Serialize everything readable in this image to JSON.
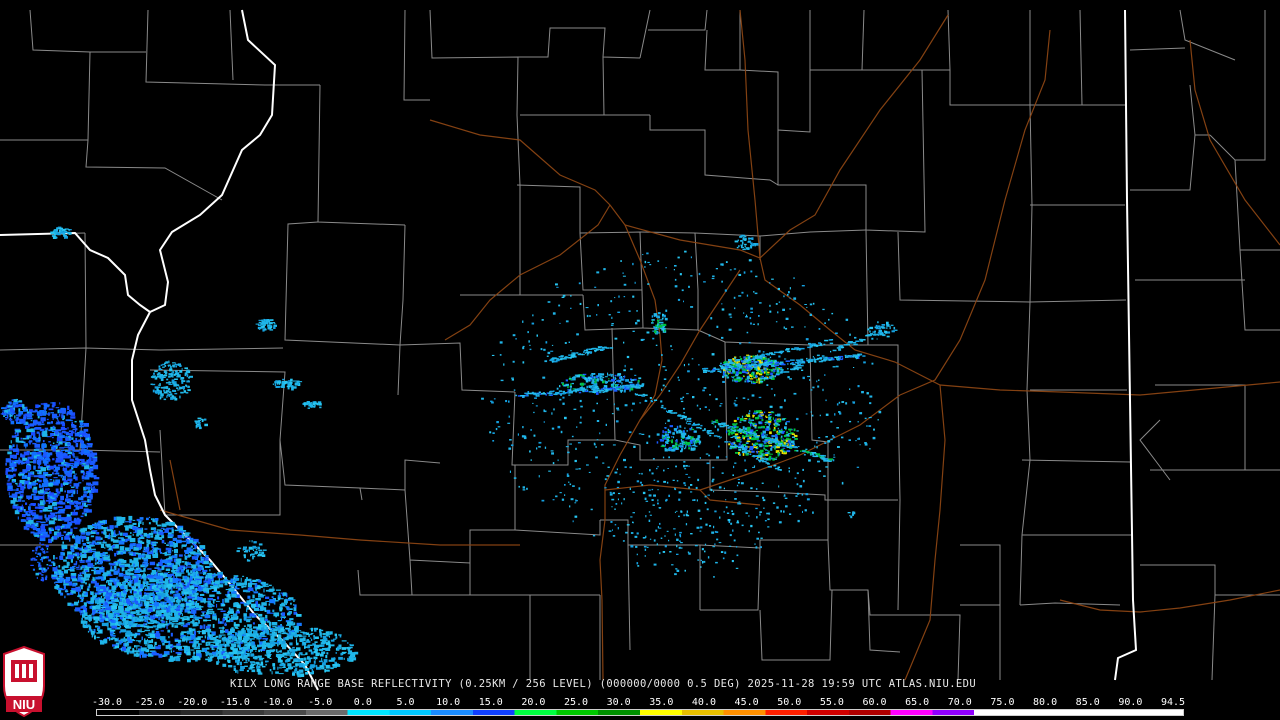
{
  "product": {
    "caption": "KILX LONG RANGE BASE REFLECTIVITY (0.25KM / 256 LEVEL) (000000/0000 0.5 DEG) 2025-11-28 19:59 UTC  ATLAS.NIU.EDU"
  },
  "logo": {
    "text": "NIU",
    "color": "#c8102e"
  },
  "scale": {
    "labels": [
      "-30.0",
      "-25.0",
      "-20.0",
      "-15.0",
      "-10.0",
      "-5.0",
      "0.0",
      "5.0",
      "10.0",
      "15.0",
      "20.0",
      "25.0",
      "30.0",
      "35.0",
      "40.0",
      "45.0",
      "50.0",
      "55.0",
      "60.0",
      "65.0",
      "70.0",
      "75.0",
      "80.0",
      "85.0",
      "90.0",
      "94.5"
    ],
    "colors": [
      "#000000",
      "#1a1a1a",
      "#2a2a2a",
      "#3a3a3a",
      "#4a4a4a",
      "#6a6a6a",
      "#00e5ff",
      "#00c8ff",
      "#1a8cff",
      "#1040ff",
      "#00ff40",
      "#00c800",
      "#009000",
      "#ffff00",
      "#e8c000",
      "#ff9000",
      "#ff2000",
      "#d00000",
      "#b00000",
      "#ff00ff",
      "#9000ff",
      "#ffffff",
      "#ffffff",
      "#ffffff",
      "#ffffff",
      "#ffffff"
    ]
  },
  "map": {
    "colors": {
      "county_border": "#8c8c8c",
      "state_border": "#ffffff",
      "highway": "#a0522d",
      "echo_light": "#1fb5e8",
      "echo_mid": "#1a5cff",
      "echo_strong": "#00c040",
      "echo_core": "#e8e000"
    }
  }
}
